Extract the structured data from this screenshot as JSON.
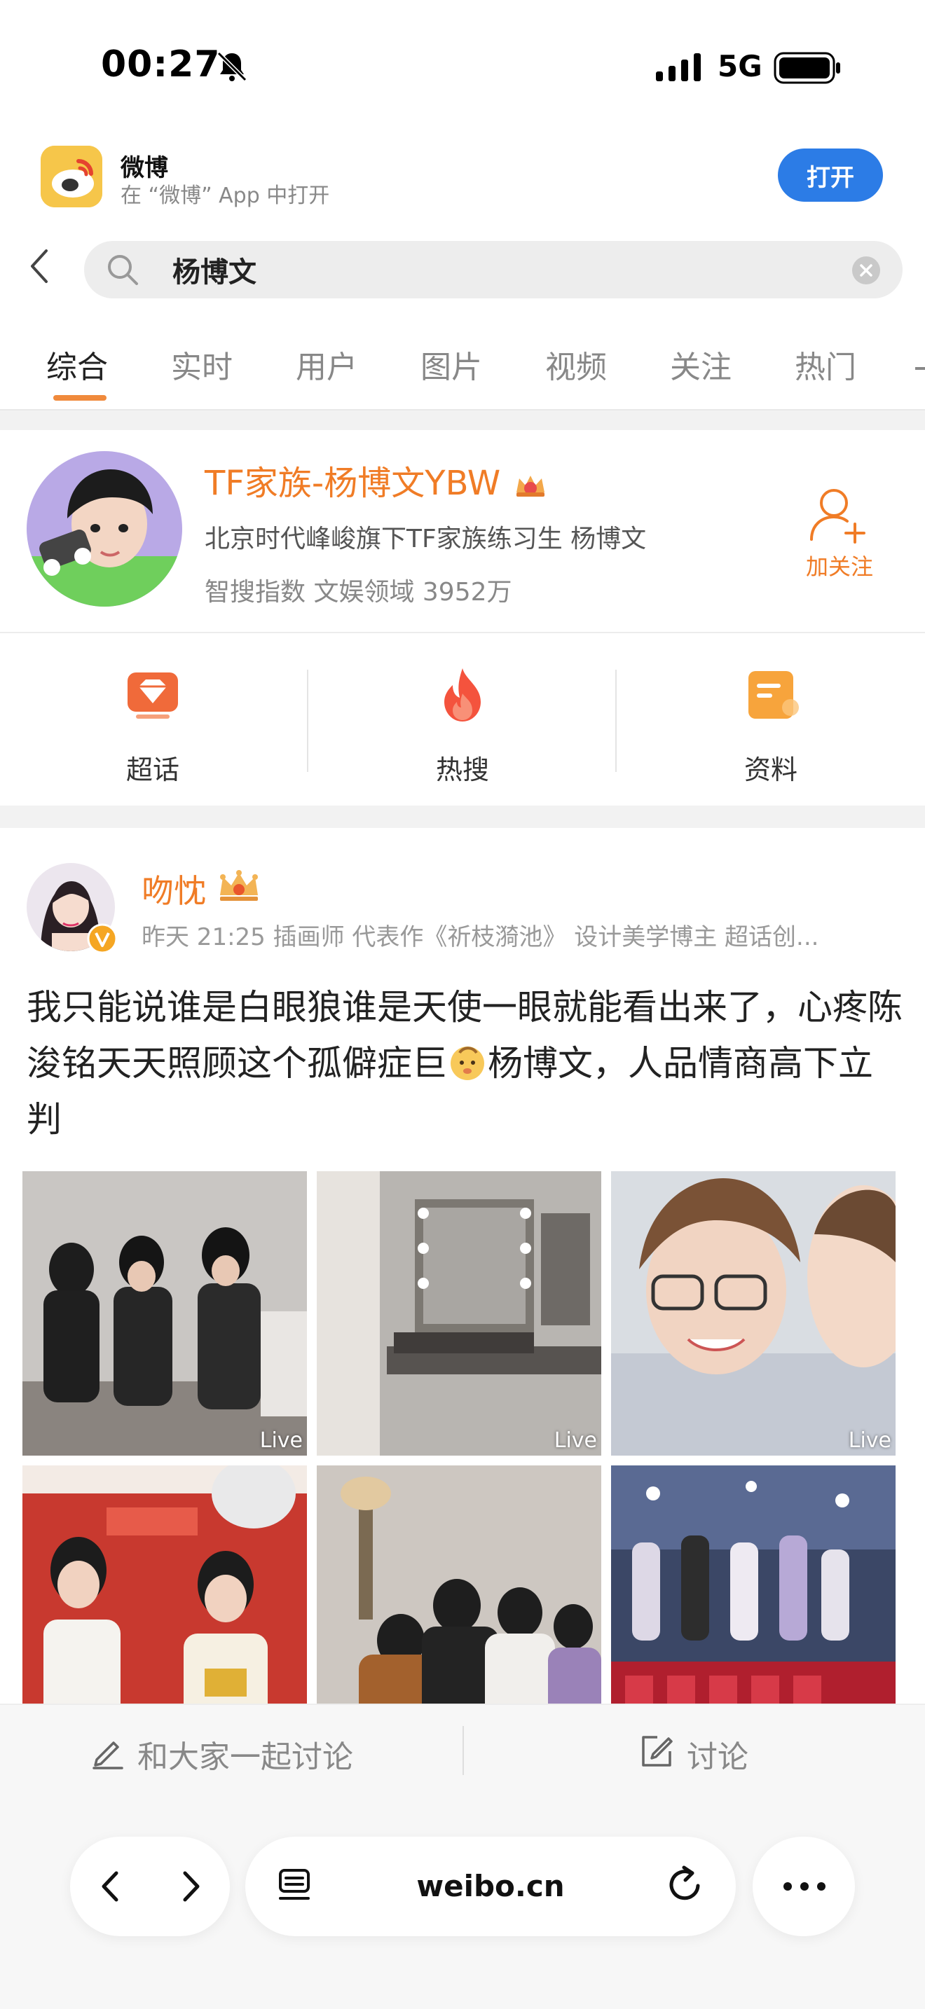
{
  "status_bar": {
    "time": "00:27",
    "network": "5G"
  },
  "app_banner": {
    "app_name": "微博",
    "subtitle": "在 “微博” App 中打开",
    "open_label": "打开"
  },
  "search": {
    "query": "杨博文"
  },
  "tabs": [
    {
      "label": "综合",
      "active": true
    },
    {
      "label": "实时"
    },
    {
      "label": "用户"
    },
    {
      "label": "图片"
    },
    {
      "label": "视频"
    },
    {
      "label": "关注"
    },
    {
      "label": "热门"
    }
  ],
  "profile_card": {
    "name": "TF家族-杨博文YBW",
    "description": "北京时代峰峻旗下TF家族练习生 杨博文",
    "index": "智搜指数 文娱领域 3952万",
    "follow_label": "加关注"
  },
  "entries": [
    {
      "label": "超话",
      "icon": "diamond-icon"
    },
    {
      "label": "热搜",
      "icon": "flame-icon"
    },
    {
      "label": "资料",
      "icon": "document-icon"
    }
  ],
  "post": {
    "author": "吻忱",
    "meta": "昨天 21:25 插画师 代表作《祈枝漪池》 设计美学博主 超话创...",
    "text_before_emoji": "我只能说谁是白眼狼谁是天使一眼就能看出来了，心疼陈浚铭天天照顾这个孤僻症巨",
    "text_after_emoji": "杨博文，人品情商高下立判",
    "photos": [
      {
        "live": "Live"
      },
      {
        "live": "Live"
      },
      {
        "live": "Live"
      },
      {
        "live": ""
      },
      {
        "live": ""
      },
      {
        "live": ""
      }
    ]
  },
  "comment_bar": {
    "input_placeholder": "和大家一起讨论",
    "discuss_label": "讨论"
  },
  "browser": {
    "url": "weibo.cn"
  },
  "colors": {
    "accent_orange": "#f07c26",
    "button_blue": "#2c7ce6"
  }
}
